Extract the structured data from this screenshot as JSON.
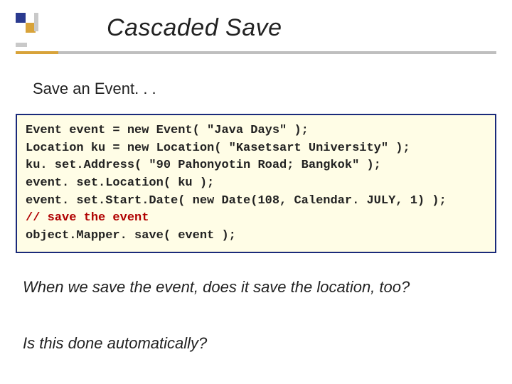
{
  "title": "Cascaded Save",
  "intro": "Save an Event. . .",
  "code": {
    "l1": "Event event = new Event( \"Java Days\" );",
    "l2": "Location ku = new Location( \"Kasetsart University\" );",
    "l3": "ku. set.Address( \"90 Pahonyotin Road; Bangkok\" );",
    "l4": "event. set.Location( ku );",
    "l5": "event. set.Start.Date( new Date(108, Calendar. JULY, 1) );",
    "l6": "// save the event",
    "l7": "object.Mapper. save( event );"
  },
  "para1": "When we save the event, does it save the location, too?",
  "para2": "Is this done automatically?"
}
